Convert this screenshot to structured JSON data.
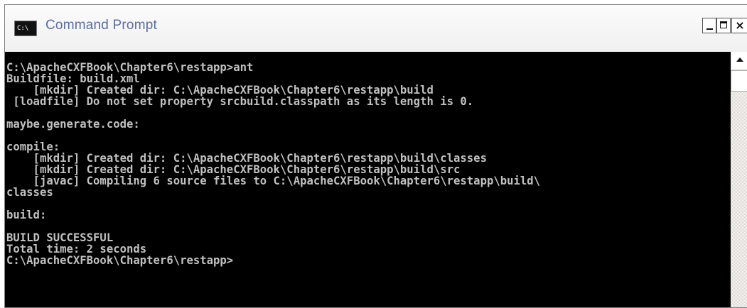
{
  "window": {
    "title": "Command Prompt",
    "icon_label": "C:\\",
    "controls": {
      "minimize": "minimize",
      "maximize": "maximize",
      "close": "×"
    }
  },
  "console": {
    "lines": [
      "C:\\ApacheCXFBook\\Chapter6\\restapp>ant",
      "Buildfile: build.xml",
      "    [mkdir] Created dir: C:\\ApacheCXFBook\\Chapter6\\restapp\\build",
      " [loadfile] Do not set property srcbuild.classpath as its length is 0.",
      "",
      "maybe.generate.code:",
      "",
      "compile:",
      "    [mkdir] Created dir: C:\\ApacheCXFBook\\Chapter6\\restapp\\build\\classes",
      "    [mkdir] Created dir: C:\\ApacheCXFBook\\Chapter6\\restapp\\build\\src",
      "    [javac] Compiling 6 source files to C:\\ApacheCXFBook\\Chapter6\\restapp\\build\\",
      "classes",
      "",
      "build:",
      "",
      "BUILD SUCCESSFUL",
      "Total time: 2 seconds",
      "C:\\ApacheCXFBook\\Chapter6\\restapp>"
    ]
  },
  "colors": {
    "console_bg": "#000000",
    "console_fg": "#c0c0c0",
    "title_text": "#5a6ea0"
  }
}
